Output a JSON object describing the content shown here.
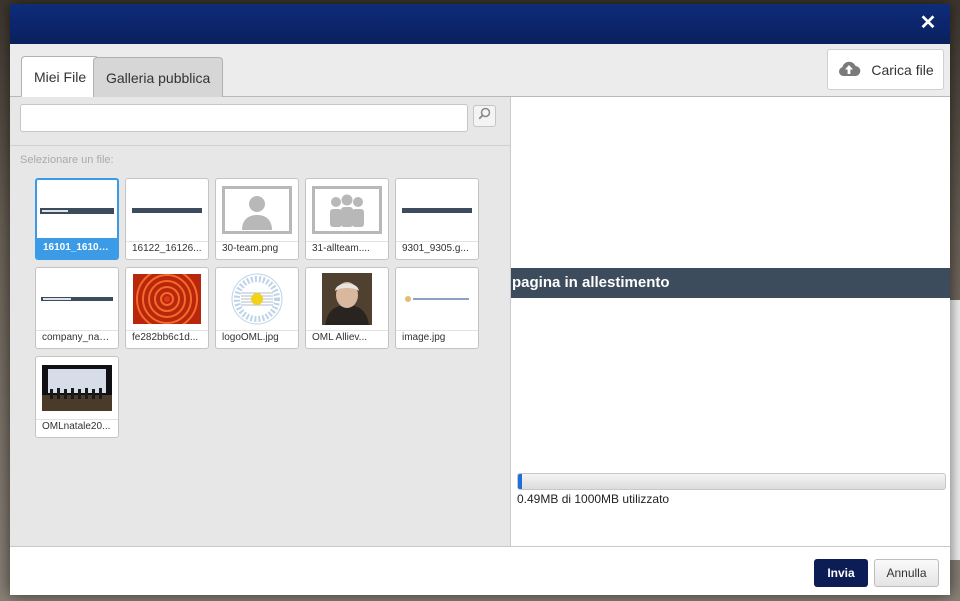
{
  "dialog": {
    "close_label": "✕"
  },
  "tabs": [
    {
      "label": "Miei File",
      "active": true
    },
    {
      "label": "Galleria pubblica",
      "active": false
    }
  ],
  "upload_button": {
    "label": "Carica file",
    "icon": "cloud-upload-icon"
  },
  "search": {
    "value": "",
    "placeholder": "",
    "icon": "magnifier-icon"
  },
  "file_list": {
    "label": "Selezionare un file:",
    "files": [
      {
        "name": "16101_16105...",
        "thumb": "banner-text",
        "selected": true
      },
      {
        "name": "16122_16126...",
        "thumb": "banner-bar"
      },
      {
        "name": "30-team.png",
        "thumb": "person"
      },
      {
        "name": "31-allteam....",
        "thumb": "group"
      },
      {
        "name": "9301_9305.g...",
        "thumb": "banner-bar"
      },
      {
        "name": "company_nam...",
        "thumb": "banner-text-small"
      },
      {
        "name": "fe282bb6c1d...",
        "thumb": "flower"
      },
      {
        "name": "logoOML.jpg",
        "thumb": "logo-oml"
      },
      {
        "name": "OML Alliev...",
        "thumb": "portrait"
      },
      {
        "name": "image.jpg",
        "thumb": "logo-strip"
      },
      {
        "name": "OMLnatale20...",
        "thumb": "concert"
      }
    ]
  },
  "preview": {
    "banner_text": "pagina in allestimento"
  },
  "quota": {
    "text": "0.49MB di 1000MB utilizzato",
    "used_fraction": 0.0049
  },
  "footer": {
    "send_label": "Invia",
    "cancel_label": "Annulla"
  },
  "colors": {
    "titlebar": "#0a1f5e",
    "selection": "#3b9be6",
    "banner": "#3c4c5c",
    "send_button": "#0c1d55"
  }
}
